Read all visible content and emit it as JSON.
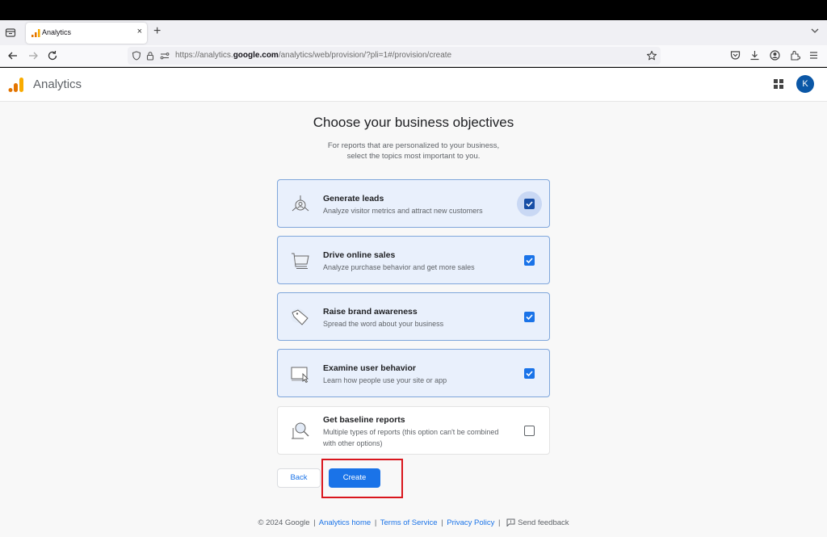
{
  "browser": {
    "tab": {
      "title": "Analytics",
      "close_glyph": "×"
    },
    "new_tab_glyph": "+",
    "url": {
      "prefix": "https://analytics.",
      "domain": "google.com",
      "path": "/analytics/web/provision/?pli=1#/provision/create"
    }
  },
  "app": {
    "title": "Analytics",
    "avatar_initial": "K",
    "logo_colors": [
      "#e37400",
      "#f9ab00"
    ]
  },
  "page": {
    "title": "Choose your business objectives",
    "subtitle_line1": "For reports that are personalized to your business,",
    "subtitle_line2": "select the topics most important to you."
  },
  "objectives": [
    {
      "icon": "leads-icon",
      "title": "Generate leads",
      "description": "Analyze visitor metrics and attract new customers",
      "checked": true
    },
    {
      "icon": "cart-icon",
      "title": "Drive online sales",
      "description": "Analyze purchase behavior and get more sales",
      "checked": true
    },
    {
      "icon": "tag-icon",
      "title": "Raise brand awareness",
      "description": "Spread the word about your business",
      "checked": true
    },
    {
      "icon": "screen-cursor-icon",
      "title": "Examine user behavior",
      "description": "Learn how people use your site or app",
      "checked": true
    },
    {
      "icon": "magnifier-report-icon",
      "title": "Get baseline reports",
      "description_line1": "Multiple types of reports (this option can't be combined",
      "description_line2": "with other options)",
      "checked": false
    }
  ],
  "buttons": {
    "back": "Back",
    "create": "Create"
  },
  "footer": {
    "copyright": "© 2024 Google",
    "links": [
      "Analytics home",
      "Terms of Service",
      "Privacy Policy"
    ],
    "feedback": "Send feedback",
    "separator": "|"
  },
  "colors": {
    "accent": "#1a73e8",
    "highlight": "#d9161d",
    "card_selected_bg": "#e9f0fc"
  }
}
